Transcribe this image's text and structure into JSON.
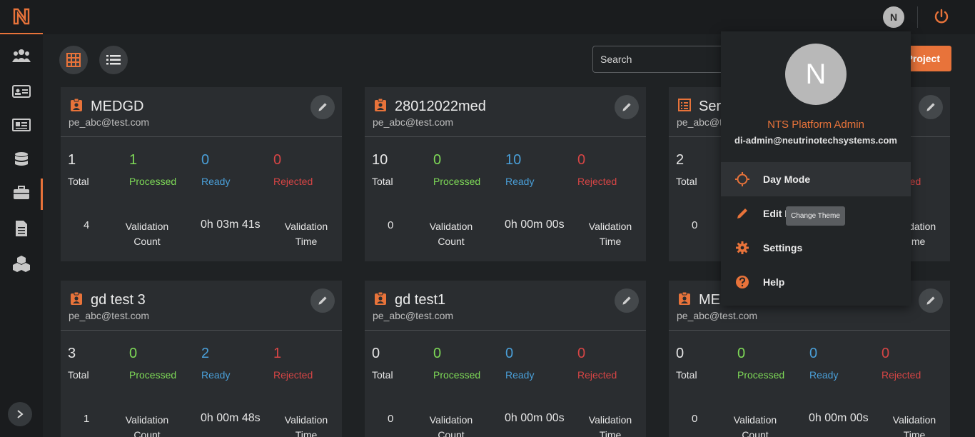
{
  "app": {
    "logo": "N"
  },
  "topbar": {
    "user_initial": "N"
  },
  "toolbar": {
    "search_placeholder": "Search",
    "add_project_label": "Project"
  },
  "cards": [
    {
      "title": "MEDGD",
      "email": "pe_abc@test.com",
      "icon": "badge-icon",
      "total": "1",
      "processed": "1",
      "ready": "0",
      "rejected": "0",
      "validation_count": "4",
      "validation_time": "0h 03m 41s"
    },
    {
      "title": "28012022med",
      "email": "pe_abc@test.com",
      "icon": "badge-icon",
      "total": "10",
      "processed": "0",
      "ready": "10",
      "rejected": "0",
      "validation_count": "0",
      "validation_time": "0h 00m 00s"
    },
    {
      "title": "Ser",
      "email": "pe_abc@t",
      "icon": "list-doc-icon",
      "total": "2",
      "processed": "",
      "ready": "",
      "rejected": "ed",
      "validation_count": "0",
      "validation_time": "",
      "label_time_partial": "me",
      "label_val_partial": "lation"
    },
    {
      "title": "gd test 3",
      "email": "pe_abc@test.com",
      "icon": "badge-icon",
      "total": "3",
      "processed": "0",
      "ready": "2",
      "rejected": "1",
      "validation_count": "1",
      "validation_time": "0h 00m 48s"
    },
    {
      "title": "gd test1",
      "email": "pe_abc@test.com",
      "icon": "badge-icon",
      "total": "0",
      "processed": "0",
      "ready": "0",
      "rejected": "0",
      "validation_count": "0",
      "validation_time": "0h 00m 00s"
    },
    {
      "title": "ME",
      "email": "pe_abc@test.com",
      "icon": "badge-icon",
      "total": "0",
      "processed": "0",
      "ready": "0",
      "rejected": "0",
      "validation_count": "0",
      "validation_time": "0h 00m 00s"
    }
  ],
  "labels": {
    "total": "Total",
    "processed": "Processed",
    "ready": "Ready",
    "rejected": "Rejected",
    "validation_line1": "Validation",
    "count_line2": "Count",
    "time_line2": "Time"
  },
  "dropdown": {
    "avatar_initial": "N",
    "name": "NTS Platform Admin",
    "email": "di-admin@neutrinotechsystems.com",
    "items": [
      {
        "label": "Day Mode",
        "icon": "sun-icon"
      },
      {
        "label": "Edit P",
        "icon": "pencil-icon"
      },
      {
        "label": "Settings",
        "icon": "gear-icon"
      },
      {
        "label": "Help",
        "icon": "help-icon"
      }
    ],
    "tooltip": "Change Theme"
  },
  "colors": {
    "accent": "#e8733a",
    "processed": "#7ed957",
    "ready": "#4a9fd8",
    "rejected": "#d64545"
  }
}
